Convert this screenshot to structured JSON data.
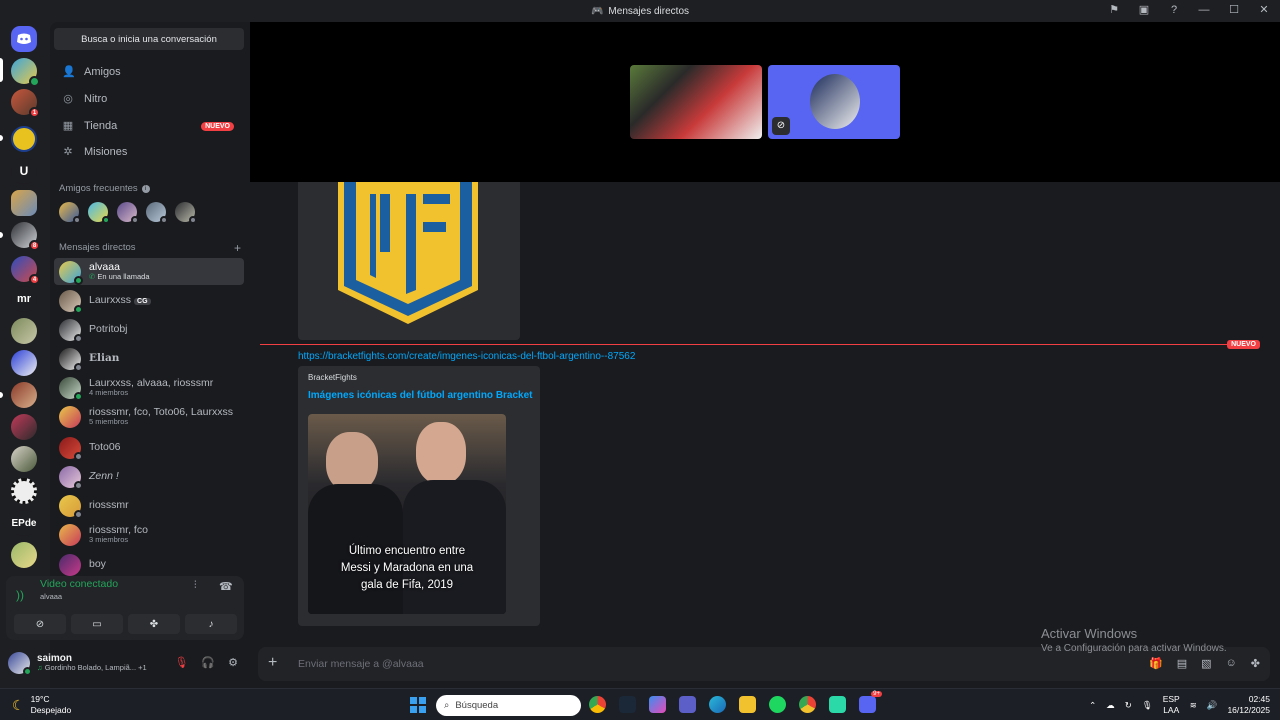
{
  "window": {
    "title": "Mensajes directos"
  },
  "sidebar": {
    "search_label": "Busca o inicia una conversación",
    "nav": [
      {
        "label": "Amigos",
        "icon": "friends-icon"
      },
      {
        "label": "Nitro",
        "icon": "nitro-icon"
      },
      {
        "label": "Tienda",
        "icon": "shop-icon",
        "badge": "NUEVO"
      },
      {
        "label": "Misiones",
        "icon": "quests-icon"
      }
    ],
    "frequent_header": "Amigos frecuentes",
    "dm_header": "Mensajes directos",
    "dms": [
      {
        "name": "alvaaa",
        "sub": "En una llamada",
        "active": true
      },
      {
        "name": "Laurxxss",
        "tag": "CG"
      },
      {
        "name": "Potritobj"
      },
      {
        "name": "Elian"
      },
      {
        "name": "Laurxxss, alvaaa, riosssmr",
        "sub": "4 miembros"
      },
      {
        "name": "riosssmr, fco, Toto06, Laurxxss",
        "sub": "5 miembros"
      },
      {
        "name": "Toto06"
      },
      {
        "name": "Zenn !"
      },
      {
        "name": "riosssmr"
      },
      {
        "name": "riosssmr, fco",
        "sub": "3 miembros"
      },
      {
        "name": "boy"
      }
    ]
  },
  "voice": {
    "status": "Video conectado",
    "channel": "alvaaa"
  },
  "user": {
    "name": "saimon",
    "status": "Gordinho Bolado, Lampiã...",
    "extra": "+1"
  },
  "rail": {
    "labels": {
      "u": "U",
      "mr": "mr",
      "epde": "EPde"
    },
    "badges": {
      "a": "1",
      "b": "8",
      "c": "4"
    }
  },
  "chat": {
    "new_label": "NUEVO",
    "link": "https://bracketfights.com/create/imgenes-iconicas-del-ftbol-argentino--87562",
    "embed_provider": "BracketFights",
    "embed_title": "Imágenes icónicas del fútbol argentino  Bracket",
    "embed_caption_1": "Último encuentro entre",
    "embed_caption_2": "Messi y Maradona en una",
    "embed_caption_3": "gala de Fifa, 2019",
    "composer_placeholder": "Enviar mensaje a @alvaaa"
  },
  "watermark": {
    "line1": "Activar Windows",
    "line2": "Ve a Configuración para activar Windows."
  },
  "taskbar": {
    "weather_temp": "19°C",
    "weather_desc": "Despejado",
    "search": "Búsqueda",
    "lang1": "ESP",
    "lang2": "LAA",
    "time": "02:45",
    "date": "16/12/2025",
    "discord_badge": "9+"
  }
}
